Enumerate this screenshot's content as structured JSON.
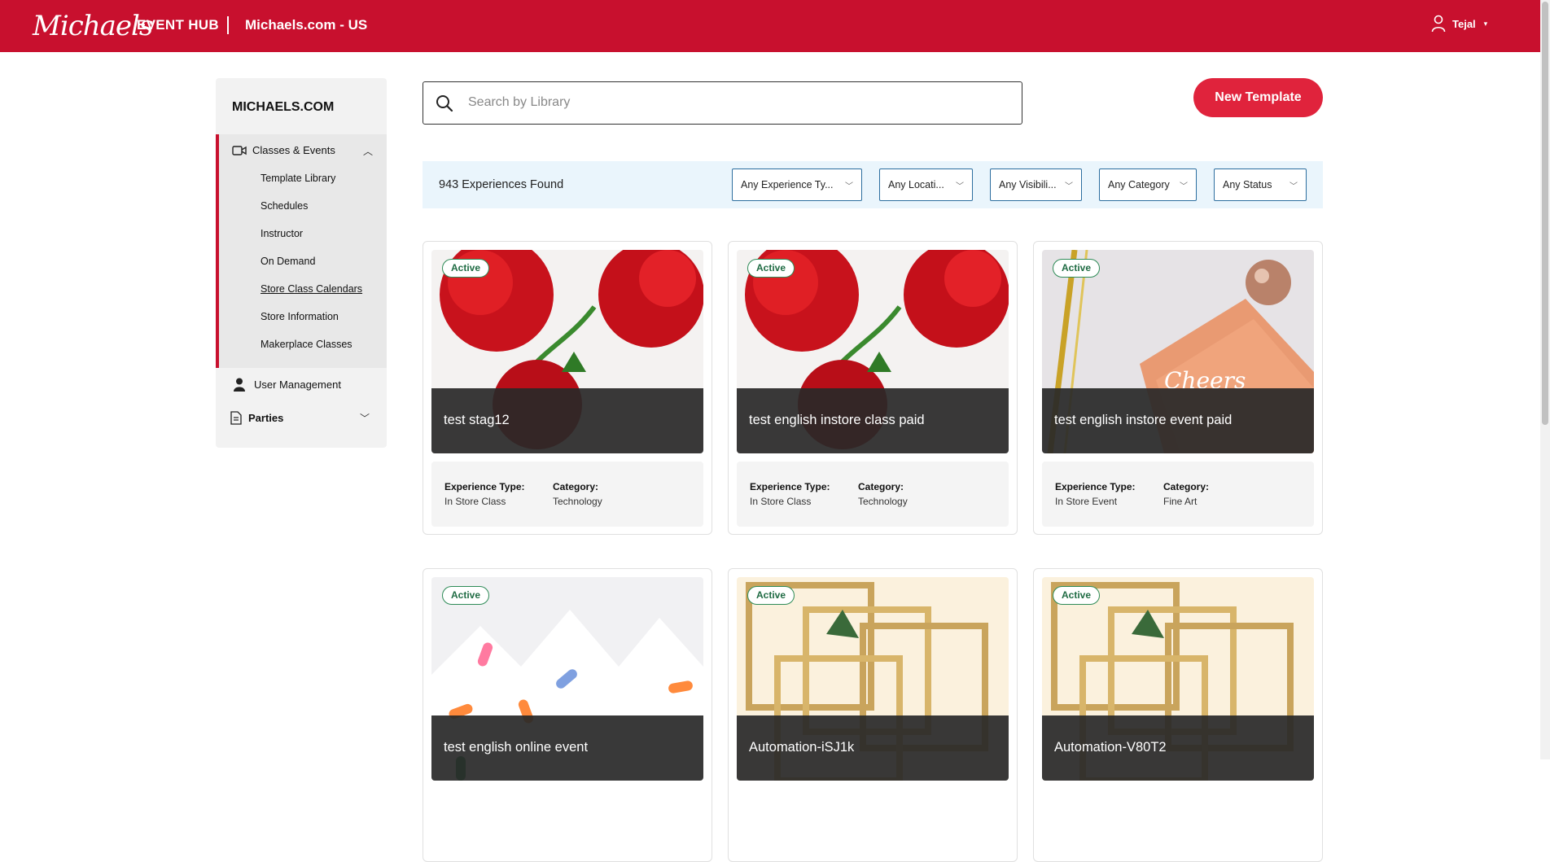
{
  "header": {
    "logo": "Michaels",
    "hub_title": "EVENT HUB",
    "site_name": "Michaels.com - US",
    "user_name": "Tejal"
  },
  "sidebar": {
    "heading": "MICHAELS.COM",
    "classes_events": "Classes & Events",
    "sub_items": [
      "Template Library",
      "Schedules",
      "Instructor",
      "On Demand",
      "Store Class Calendars",
      "Store Information",
      "Makerplace Classes"
    ],
    "user_management": "User Management",
    "parties": "Parties"
  },
  "search": {
    "placeholder": "Search by Library",
    "value": ""
  },
  "new_template_label": "New Template",
  "results": {
    "count_text": "943 Experiences Found",
    "filters": [
      "Any Experience Ty...",
      "Any Locati...",
      "Any Visibili...",
      "Any Category",
      "Any Status"
    ]
  },
  "labels": {
    "experience_type": "Experience Type:",
    "category": "Category:"
  },
  "colors": {
    "brand_red": "#c8102e",
    "button_red": "#e0233c",
    "active_green": "#1f6b43",
    "filter_border": "#2c6e9f"
  },
  "cards": [
    {
      "title": "test stag12",
      "status": "Active",
      "experience_type": "In Store Class",
      "category": "Technology",
      "image": "roses"
    },
    {
      "title": "test english instore class paid",
      "status": "Active",
      "experience_type": "In Store Class",
      "category": "Technology",
      "image": "roses"
    },
    {
      "title": "test english instore event paid",
      "status": "Active",
      "experience_type": "In Store Event",
      "category": "Fine Art",
      "image": "napkins-disco-ball"
    },
    {
      "title": "test english online event",
      "status": "Active",
      "image": "birthday-crown"
    },
    {
      "title": "Automation-iSJ1k",
      "status": "Active",
      "image": "gold-frames"
    },
    {
      "title": "Automation-V80T2",
      "status": "Active",
      "image": "gold-frames"
    }
  ]
}
